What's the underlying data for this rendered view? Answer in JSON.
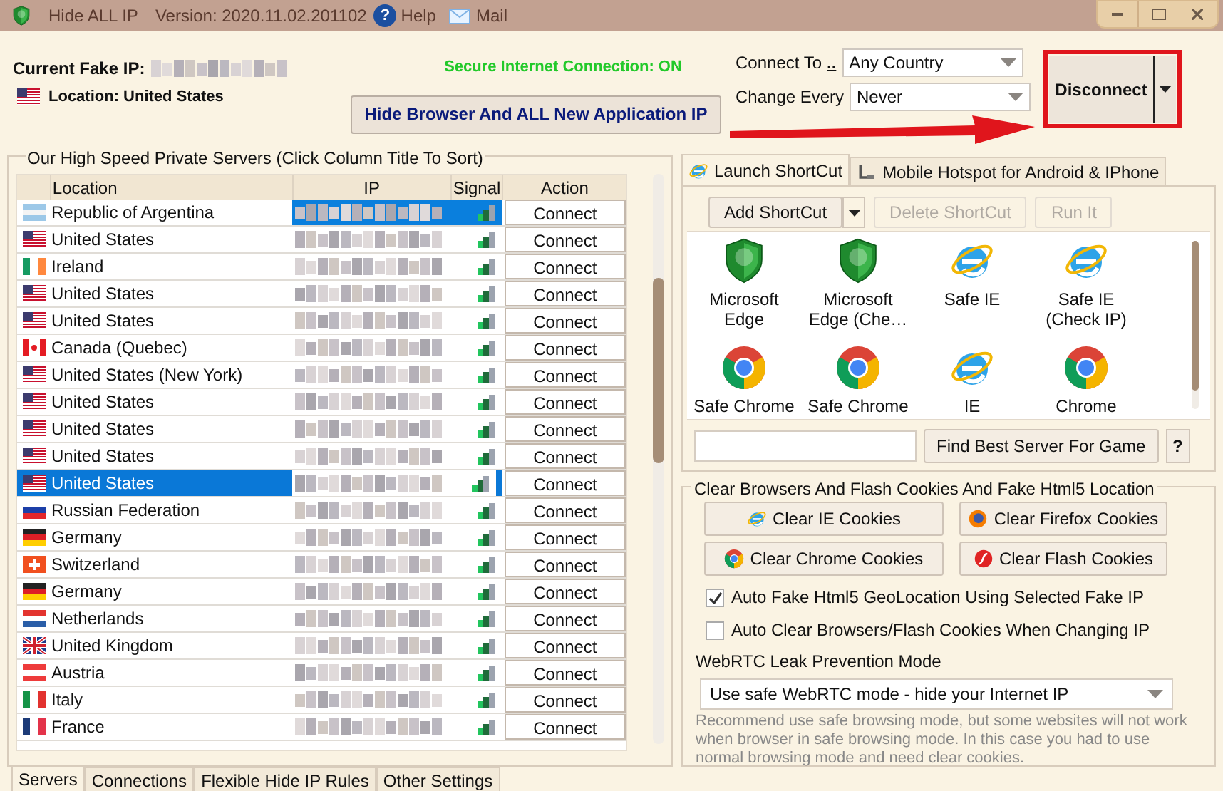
{
  "window": {
    "app_name": "Hide ALL IP",
    "version": "Version: 2020.11.02.201102",
    "help_glyph": "?",
    "help": "Help",
    "mail": "Mail"
  },
  "header": {
    "fake_ip_label": "Current Fake IP:",
    "location": "Location: United States",
    "location_flag": {
      "kind": "us"
    },
    "status": "Secure Internet Connection: ON",
    "hide_button": "Hide Browser And ALL New Application IP",
    "connect_to_label": "Connect To",
    "connect_to_link": "..",
    "connect_to_value": "Any Country",
    "change_every_label": "Change Every",
    "change_every_value": "Never",
    "disconnect": "Disconnect"
  },
  "servers": {
    "legend": "Our High Speed Private Servers (Click Column Title To Sort)",
    "columns": [
      "Location",
      "IP",
      "Signal",
      "Action"
    ],
    "rows": [
      {
        "location": "Republic of Argentina",
        "flag": {
          "kind": "ar"
        },
        "action": "Connect",
        "selected": false,
        "ip_selected": true
      },
      {
        "location": "United States",
        "flag": {
          "kind": "us"
        },
        "action": "Connect",
        "selected": false,
        "ip_selected": false
      },
      {
        "location": "Ireland",
        "flag": {
          "kind": "ie"
        },
        "action": "Connect",
        "selected": false,
        "ip_selected": false
      },
      {
        "location": "United States",
        "flag": {
          "kind": "us"
        },
        "action": "Connect",
        "selected": false,
        "ip_selected": false
      },
      {
        "location": "United States",
        "flag": {
          "kind": "us"
        },
        "action": "Connect",
        "selected": false,
        "ip_selected": false
      },
      {
        "location": "Canada (Quebec)",
        "flag": {
          "kind": "ca"
        },
        "action": "Connect",
        "selected": false,
        "ip_selected": false
      },
      {
        "location": "United States (New York)",
        "flag": {
          "kind": "us"
        },
        "action": "Connect",
        "selected": false,
        "ip_selected": false
      },
      {
        "location": "United States",
        "flag": {
          "kind": "us"
        },
        "action": "Connect",
        "selected": false,
        "ip_selected": false
      },
      {
        "location": "United States",
        "flag": {
          "kind": "us"
        },
        "action": "Connect",
        "selected": false,
        "ip_selected": false
      },
      {
        "location": "United States",
        "flag": {
          "kind": "us"
        },
        "action": "Connect",
        "selected": false,
        "ip_selected": false
      },
      {
        "location": "United States",
        "flag": {
          "kind": "us"
        },
        "action": "Connect",
        "selected": true,
        "ip_selected": false
      },
      {
        "location": "Russian Federation",
        "flag": {
          "kind": "ru"
        },
        "action": "Connect",
        "selected": false,
        "ip_selected": false
      },
      {
        "location": "Germany",
        "flag": {
          "kind": "de"
        },
        "action": "Connect",
        "selected": false,
        "ip_selected": false
      },
      {
        "location": "Switzerland",
        "flag": {
          "kind": "ch"
        },
        "action": "Connect",
        "selected": false,
        "ip_selected": false
      },
      {
        "location": "Germany",
        "flag": {
          "kind": "de"
        },
        "action": "Connect",
        "selected": false,
        "ip_selected": false
      },
      {
        "location": "Netherlands",
        "flag": {
          "kind": "nl"
        },
        "action": "Connect",
        "selected": false,
        "ip_selected": false
      },
      {
        "location": "United Kingdom",
        "flag": {
          "kind": "gb"
        },
        "action": "Connect",
        "selected": false,
        "ip_selected": false
      },
      {
        "location": "Austria",
        "flag": {
          "kind": "at"
        },
        "action": "Connect",
        "selected": false,
        "ip_selected": false
      },
      {
        "location": "Italy",
        "flag": {
          "kind": "it"
        },
        "action": "Connect",
        "selected": false,
        "ip_selected": false
      },
      {
        "location": "France",
        "flag": {
          "kind": "fr"
        },
        "action": "Connect",
        "selected": false,
        "ip_selected": false
      }
    ]
  },
  "bottom_tabs": [
    {
      "label": "Servers",
      "selected": true
    },
    {
      "label": "Connections",
      "selected": false
    },
    {
      "label": "Flexible Hide IP Rules",
      "selected": false
    },
    {
      "label": "Other Settings",
      "selected": false
    }
  ],
  "right_tabs": [
    {
      "label": "Launch ShortCut",
      "kind": "ie",
      "selected": true
    },
    {
      "label": "Mobile Hotspot for Android & IPhone",
      "kind": "hotspot",
      "selected": false
    }
  ],
  "toolbar": [
    {
      "label": "Add ShortCut",
      "disabled": false,
      "dropdown": true
    },
    {
      "label": "Delete ShortCut",
      "disabled": true,
      "dropdown": false
    },
    {
      "label": "Run It",
      "disabled": true,
      "dropdown": false
    }
  ],
  "shortcuts": [
    {
      "label": "Microsoft Edge",
      "kind": "shield"
    },
    {
      "label": "Microsoft Edge (Che…",
      "kind": "shield"
    },
    {
      "label": "Safe IE",
      "kind": "ie"
    },
    {
      "label": "Safe IE (Check IP)",
      "kind": "ie"
    },
    {
      "label": "Safe Chrome",
      "kind": "chrome"
    },
    {
      "label": "Safe Chrome",
      "kind": "chrome"
    },
    {
      "label": "IE",
      "kind": "ie"
    },
    {
      "label": "Chrome",
      "kind": "chrome"
    }
  ],
  "game": {
    "find_button": "Find Best Server For Game",
    "help_button": "?"
  },
  "cookies": {
    "legend": "Clear Browsers And Flash Cookies And Fake Html5 Location",
    "buttons": [
      {
        "label": "Clear IE Cookies",
        "kind": "ie"
      },
      {
        "label": "Clear Firefox Cookies",
        "kind": "firefox"
      },
      {
        "label": "Clear Chrome Cookies",
        "kind": "chrome"
      },
      {
        "label": "Clear Flash Cookies",
        "kind": "flash"
      }
    ],
    "options": [
      {
        "label": "Auto Fake Html5 GeoLocation Using Selected Fake IP",
        "checked": true
      },
      {
        "label": "Auto Clear Browsers/Flash Cookies When Changing IP",
        "checked": false
      }
    ],
    "webrtc_label": "WebRTC Leak Prevention Mode",
    "webrtc_value": "Use safe WebRTC mode - hide your Internet IP",
    "note": "Recommend use safe browsing mode, but some websites will not work when browser in safe browsing mode. In this case you had to use normal browsing mode and need clear cookies."
  }
}
